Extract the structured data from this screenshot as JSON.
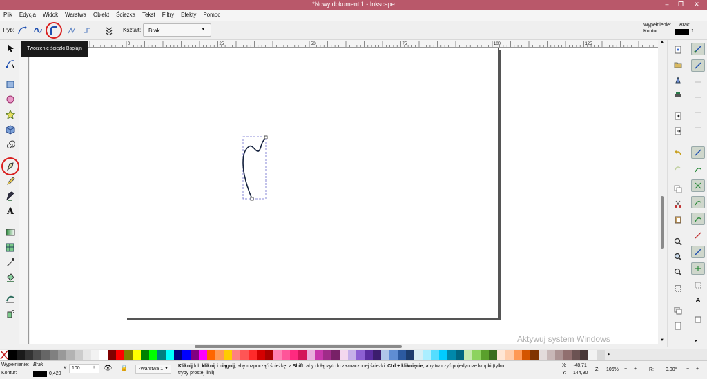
{
  "window": {
    "title": "*Nowy dokument 1 - Inkscape",
    "controls": [
      "–",
      "❐",
      "✕"
    ]
  },
  "menu": [
    "Plik",
    "Edycja",
    "Widok",
    "Warstwa",
    "Obiekt",
    "Ścieżka",
    "Tekst",
    "Filtry",
    "Efekty",
    "Pomoc"
  ],
  "tool_controls": {
    "mode_label": "Tryb:",
    "shape_label": "Kształt:",
    "shape_value": "Brak",
    "tooltip": "Tworzenie ścieżki Bsplajn",
    "fill_label": "Wypełnienie:",
    "fill_value": "Brak",
    "stroke_label": "Kontur:",
    "stroke_width": "1"
  },
  "ruler": {
    "ticks": [
      "0",
      "25",
      "50",
      "75",
      "100",
      "125",
      "150",
      "175",
      "200",
      "225",
      "250",
      "275"
    ]
  },
  "status": {
    "fill_label": "Wypełnienie:",
    "fill_value": "Brak",
    "stroke_label": "Kontur:",
    "stroke_width": "0,420",
    "opacity_label": "K:",
    "opacity_value": "100",
    "layer": "-Warstwa 1",
    "message_1": "Kliknij",
    "message_2": " lub ",
    "message_3": "kliknij i ciągnij",
    "message_4": ", aby rozpocząć ścieżkę; z ",
    "message_5": "Shift",
    "message_6": ", aby dołączyć do zaznaczonej ścieżki. ",
    "message_7": "Ctrl + kliknięcie",
    "message_8": ", aby tworzyć pojedyncze kropki (tylko",
    "message_9": "tryby prostej linii).",
    "x_label": "X:",
    "x_value": "-48,71",
    "y_label": "Y:",
    "y_value": "144,90",
    "zoom_label": "Z:",
    "zoom_value": "106%",
    "rotation_label": "R:",
    "rotation_value": "0,00°"
  },
  "watermark": {
    "line1": "Aktywuj system Windows"
  },
  "palette": [
    "#000000",
    "#1a1a1a",
    "#333333",
    "#4d4d4d",
    "#666666",
    "#808080",
    "#999999",
    "#b3b3b3",
    "#cccccc",
    "#e6e6e6",
    "#f2f2f2",
    "#ffffff",
    "#800000",
    "#ff0000",
    "#808000",
    "#ffff00",
    "#008000",
    "#00ff00",
    "#008080",
    "#00ffff",
    "#000080",
    "#0000ff",
    "#800080",
    "#ff00ff",
    "#ff6600",
    "#ff9955",
    "#ffcc00",
    "#ff8080",
    "#ff5555",
    "#ff2a2a",
    "#d40000",
    "#aa0000",
    "#ff80b2",
    "#ff5599",
    "#ff2a7f",
    "#d4145a",
    "#e9afdd",
    "#c837ab",
    "#a02c89",
    "#782167",
    "#f4d7ee",
    "#c6afe9",
    "#8d5fd3",
    "#5a2ca0",
    "#3c1d6e",
    "#afc6e9",
    "#5f8dd3",
    "#2c5aa0",
    "#1c3d6e",
    "#d7eef4",
    "#aaeeff",
    "#55ddff",
    "#00ccff",
    "#0088aa",
    "#006680",
    "#c6e9af",
    "#8dd35f",
    "#5aa02c",
    "#3c6e1c",
    "#ffe6d5",
    "#ffccaa",
    "#ff9955",
    "#d45500",
    "#803300",
    "#e3dbdb",
    "#c8b7b7",
    "#ac9393",
    "#916f6f",
    "#6c5353",
    "#483737",
    "#f2f2f2",
    "#d9d9d9"
  ],
  "colors": {
    "titlebar": "#b9586a",
    "highlight": "#d92020"
  }
}
